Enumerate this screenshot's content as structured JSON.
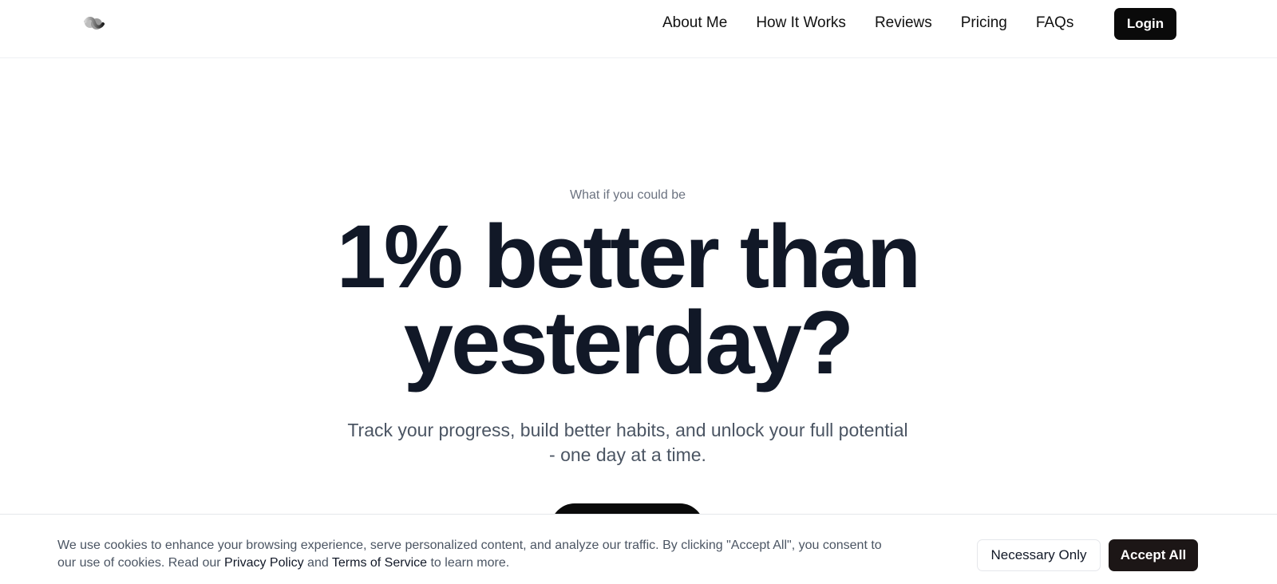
{
  "header": {
    "logo_icon": "wave-logo-icon",
    "nav": [
      {
        "label": "About Me"
      },
      {
        "label": "How It Works"
      },
      {
        "label": "Reviews"
      },
      {
        "label": "Pricing"
      },
      {
        "label": "FAQs"
      }
    ],
    "login_label": "Login"
  },
  "hero": {
    "eyebrow": "What if you could be",
    "title_line1": "1% better than",
    "title_line2": "yesterday?",
    "subtitle_line1": "Track your progress, build better habits, and unlock your full potential",
    "subtitle_line2": "- one day at a time."
  },
  "cookie_banner": {
    "text_line1": "We use cookies to enhance your browsing experience, serve personalized content, and analyze our traffic. By clicking \"Accept All\", you consent to",
    "text_line2_prefix": "our use of cookies. Read our ",
    "privacy_link": "Privacy Policy",
    "and_text": " and ",
    "terms_link": "Terms of Service",
    "text_line2_suffix": " to learn more.",
    "necessary_label": "Necessary Only",
    "accept_label": "Accept All"
  },
  "colors": {
    "primary": "#0a0a0a",
    "heading": "#111827",
    "muted": "#6b7280",
    "accept_bg": "#1c1616"
  }
}
